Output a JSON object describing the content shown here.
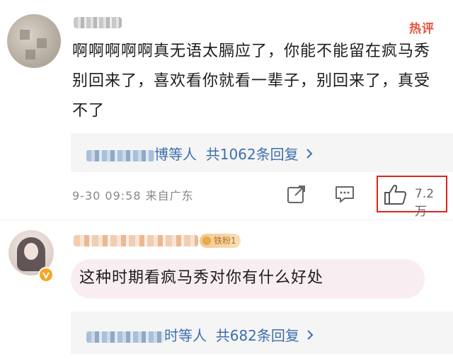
{
  "comments": [
    {
      "avatar": "avatar-blurred",
      "username_blurred": true,
      "hot_label": "热评",
      "text": "啊啊啊啊啊真无语太膈应了，你能不能留在疯马秀别回来了，喜欢看你就看一辈子，别回来了，真受不了",
      "replies": {
        "prefix_blurred": true,
        "suffix": "博等人",
        "count_text": "共1062条回复",
        "chevron": "chevron-right-icon"
      },
      "meta": "9-30 09:58 来自广东",
      "actions": {
        "share": "share-icon",
        "comment": "comment-icon",
        "like": "thumbs-up-icon",
        "like_count": "7.2万"
      },
      "highlight_color": "#e0241b"
    },
    {
      "avatar": "avatar-girl",
      "verified_badge": "verified-v-icon",
      "username_blurred": true,
      "fan_badge": "铁粉1",
      "text": "这种时期看疯马秀对你有什么好处",
      "replies": {
        "prefix_blurred": true,
        "suffix": "时等人",
        "count_text": "共682条回复",
        "chevron": "chevron-right-icon"
      }
    }
  ],
  "colors": {
    "link": "#3c6fae",
    "hot": "#e8523f",
    "bubble": "#f8eef1",
    "reply_bg": "#f5f5f5"
  }
}
